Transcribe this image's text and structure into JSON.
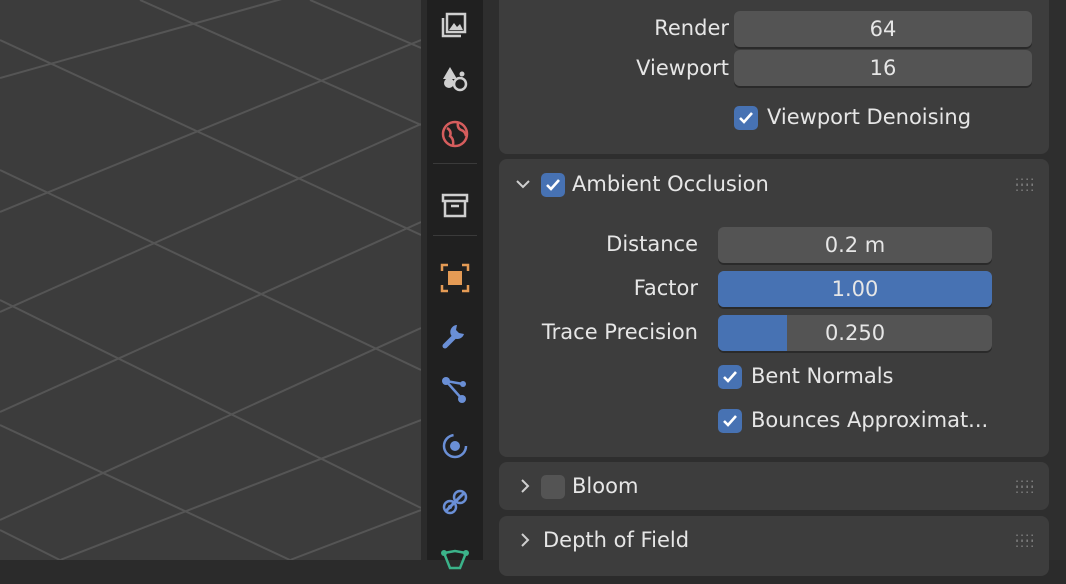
{
  "sampling": {
    "render_label": "Render",
    "render_value": "64",
    "viewport_label": "Viewport",
    "viewport_value": "16",
    "denoise_label": "Viewport Denoising"
  },
  "ambient_occlusion": {
    "title": "Ambient Occlusion",
    "distance_label": "Distance",
    "distance_value": "0.2 m",
    "factor_label": "Factor",
    "factor_value": "1.00",
    "factor_fraction": 1.0,
    "precision_label": "Trace Precision",
    "precision_value": "0.250",
    "precision_fraction": 0.25,
    "bent_normals_label": "Bent Normals",
    "bounces_label": "Bounces Approximat..."
  },
  "bloom": {
    "title": "Bloom"
  },
  "dof": {
    "title": "Depth of Field"
  },
  "colors": {
    "accent": "#4772b3",
    "field": "#545454",
    "panel": "#3d3d3d"
  },
  "icons": [
    "output-icon",
    "view-layer-icon",
    "world-icon",
    "collection-icon",
    "object-icon",
    "modifier-icon",
    "particles-icon",
    "physics-icon",
    "constraints-icon",
    "object-data-icon"
  ]
}
